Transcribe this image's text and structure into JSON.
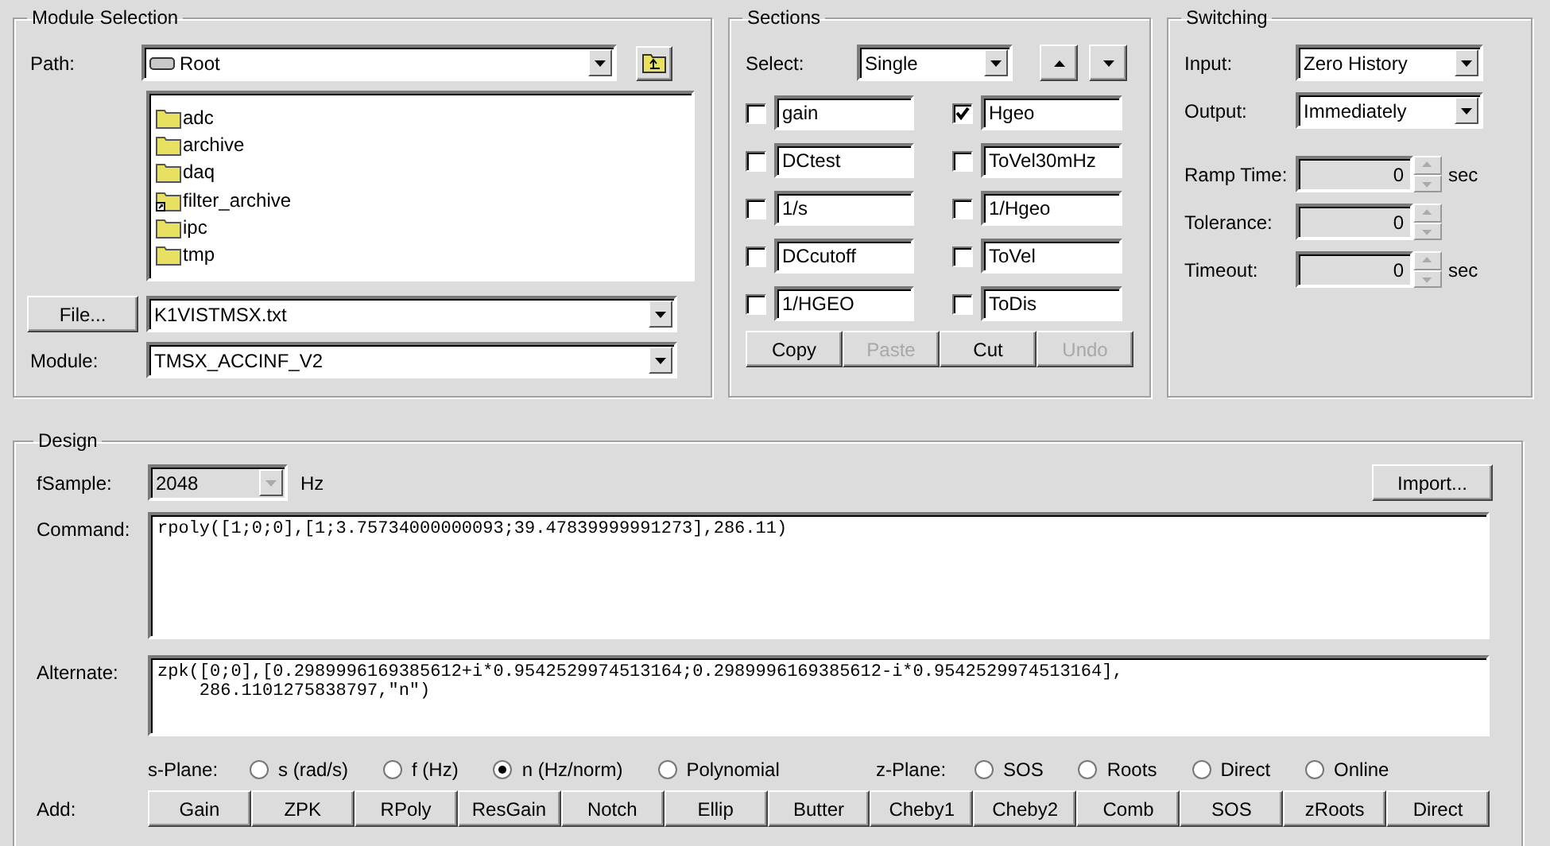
{
  "module_selection": {
    "title": "Module Selection",
    "path_label": "Path:",
    "path_value": "Root",
    "folders": [
      {
        "name": "adc",
        "kind": "folder"
      },
      {
        "name": "archive",
        "kind": "folder"
      },
      {
        "name": "daq",
        "kind": "folder"
      },
      {
        "name": "filter_archive",
        "kind": "link"
      },
      {
        "name": "ipc",
        "kind": "folder"
      },
      {
        "name": "tmp",
        "kind": "folder"
      }
    ],
    "file_button": "File...",
    "file_value": "K1VISTMSX.txt",
    "module_label": "Module:",
    "module_value": "TMSX_ACCINF_V2"
  },
  "sections": {
    "title": "Sections",
    "select_label": "Select:",
    "select_value": "Single",
    "items": [
      {
        "name": "gain",
        "checked": false
      },
      {
        "name": "Hgeo",
        "checked": true
      },
      {
        "name": "DCtest",
        "checked": false
      },
      {
        "name": "ToVel30mHz",
        "checked": false
      },
      {
        "name": "1/s",
        "checked": false
      },
      {
        "name": "1/Hgeo",
        "checked": false
      },
      {
        "name": "DCcutoff",
        "checked": false
      },
      {
        "name": "ToVel",
        "checked": false
      },
      {
        "name": "1/HGEO",
        "checked": false
      },
      {
        "name": "ToDis",
        "checked": false
      }
    ],
    "buttons": [
      {
        "label": "Copy",
        "disabled": false
      },
      {
        "label": "Paste",
        "disabled": true
      },
      {
        "label": "Cut",
        "disabled": false
      },
      {
        "label": "Undo",
        "disabled": true
      }
    ]
  },
  "switching": {
    "title": "Switching",
    "input_label": "Input:",
    "input_value": "Zero History",
    "output_label": "Output:",
    "output_value": "Immediately",
    "params": [
      {
        "label": "Ramp Time:",
        "value": "0",
        "unit": "sec"
      },
      {
        "label": "Tolerance:",
        "value": "0"
      },
      {
        "label": "Timeout:",
        "value": "0",
        "unit": "sec"
      }
    ]
  },
  "design": {
    "title": "Design",
    "fsample_label": "fSample:",
    "fsample_value": "2048",
    "fsample_unit": "Hz",
    "import_button": "Import...",
    "command_label": "Command:",
    "command_value": "rpoly([1;0;0],[1;3.75734000000093;39.47839999991273],286.11)",
    "alternate_label": "Alternate:",
    "alternate_value": "zpk([0;0],[0.2989996169385612+i*0.9542529974513164;0.2989996169385612-i*0.9542529974513164],\n    286.1101275838797,\"n\")",
    "s_plane_label": "s-Plane:",
    "s_plane_options": [
      {
        "label": "s (rad/s)",
        "selected": false
      },
      {
        "label": "f (Hz)",
        "selected": false
      },
      {
        "label": "n (Hz/norm)",
        "selected": true
      },
      {
        "label": "Polynomial",
        "selected": false
      }
    ],
    "z_plane_label": "z-Plane:",
    "z_plane_options": [
      {
        "label": "SOS",
        "selected": false
      },
      {
        "label": "Roots",
        "selected": false
      },
      {
        "label": "Direct",
        "selected": false
      },
      {
        "label": "Online",
        "selected": false
      }
    ],
    "add_label": "Add:",
    "add_buttons": [
      "Gain",
      "ZPK",
      "RPoly",
      "ResGain",
      "Notch",
      "Ellip",
      "Butter",
      "Cheby1",
      "Cheby2",
      "Comb",
      "SOS",
      "zRoots",
      "Direct"
    ]
  }
}
